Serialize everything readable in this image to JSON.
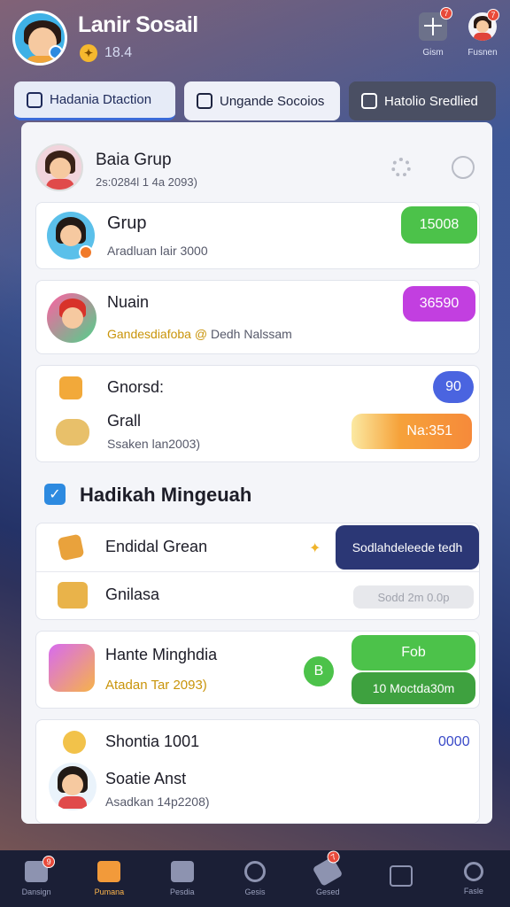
{
  "header": {
    "title": "Lanir Sosail",
    "coin_value": "18.4",
    "btn_left_label": "Gism",
    "btn_right_label": "Fusnen",
    "badge_left": "7",
    "badge_right": "7"
  },
  "tabs": [
    {
      "label": "Hadania Dtaction"
    },
    {
      "label": "Ungande Socoios"
    },
    {
      "label": "Hatolio Sredlied"
    }
  ],
  "group": {
    "title": "Baia Grup",
    "subtitle": "2s:0284l 1 4a 2093)"
  },
  "cards": [
    {
      "title": "Grup",
      "subtitle": "Aradluan lair 3000",
      "pill": "15008"
    },
    {
      "title": "Nuain",
      "subtitle_highlight": "Gandesdiafoba @",
      "subtitle_rest": "Dedh Nalssam",
      "pill": "36590"
    },
    {
      "title1": "Gnorsd:",
      "title2": "Grall",
      "subtitle": "Ssaken lan2003)",
      "badge": "90",
      "pill": "Na:351"
    }
  ],
  "weekly": {
    "title": "Hadikah Mingeuah",
    "rows": [
      {
        "title": "Endidal Grean",
        "button": "Sodlahdeleede tedh"
      },
      {
        "title": "Gnilasa",
        "pill": "Sodd 2m 0.0p"
      }
    ]
  },
  "reward_card": {
    "title": "Hante Minghdia",
    "subtitle": "Atadan Tar 2093)",
    "badge": "B",
    "button_top": "Fob",
    "button_bottom": "10 Moctda30m"
  },
  "last_card": {
    "title1": "Shontia 1001",
    "value": "0000",
    "title2": "Soatie Anst",
    "subtitle": "Asadkan 14p2208)"
  },
  "nav": [
    {
      "label": "Dansign",
      "badge": "9"
    },
    {
      "label": "Pumana"
    },
    {
      "label": "Pesdia"
    },
    {
      "label": "Gesis"
    },
    {
      "label": "Gesed",
      "badge": "7"
    },
    {
      "label": ""
    },
    {
      "label": "Fasle"
    }
  ],
  "colors": {
    "green": "#4cc24a",
    "magenta": "#c23fe0",
    "orange": "#f6a23a",
    "navy": "#2b3775",
    "dark_green": "#3ea13f"
  }
}
